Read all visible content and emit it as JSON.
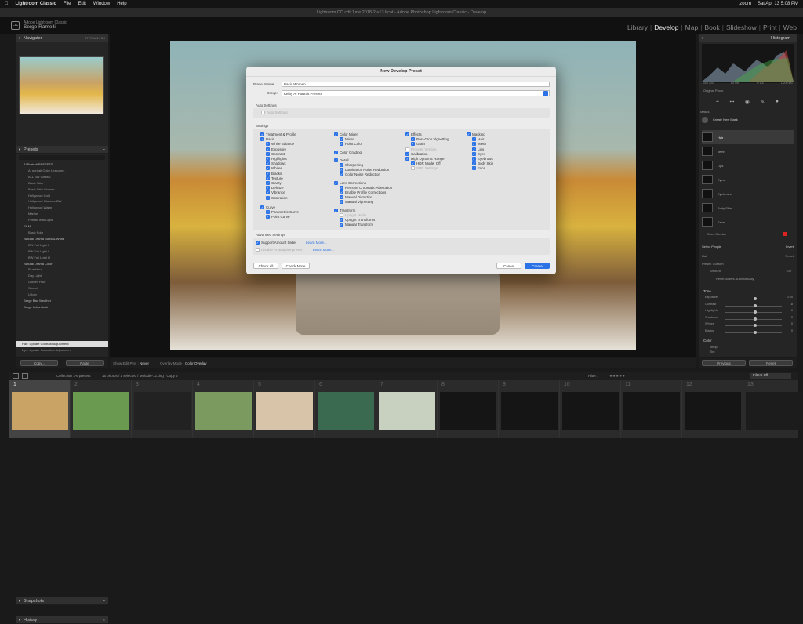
{
  "macbar": {
    "app": "Lightroom Classic",
    "menus": [
      "File",
      "Edit",
      "Window",
      "Help"
    ],
    "right": [
      "zoom",
      "Sat Apr 13 5:08 PM"
    ]
  },
  "window_title": "Lightroom CC cdt June 2018-2-v13.lrcat - Adobe Photoshop Lightroom Classic - Develop",
  "account": {
    "line1": "Adobe Lightroom Classic",
    "name": "Serge Ramelli"
  },
  "modules": [
    "Library",
    "Develop",
    "Map",
    "Book",
    "Slideshow",
    "Print",
    "Web"
  ],
  "active_module": "Develop",
  "left": {
    "navigator": "Navigator",
    "nav_zoom": [
      "FIT",
      "FILL",
      "1:1",
      "3:1"
    ],
    "presets": "Presets",
    "preset_rows": [
      "AI Portrait PRESETS",
      "AI portrait Color Lescu m4",
      "ALL BW Classic",
      "Basic Skin",
      "Basic Skin Woman",
      "Hollywood Cold",
      "Hollywood Glamour BW",
      "Hollywood Warm",
      "Marine",
      "Portrait with Light",
      "FILM",
      "Basic Fdor",
      "Natural Drama Black & White",
      "BW Full Light I",
      "BW Full Light II",
      "BW Full Light III",
      "Natural Drama Color",
      "Blue Hour",
      "Day Light",
      "Golden Hour",
      "Sunset",
      "Urban",
      "Serge Bad Weather",
      "Serge Urban look"
    ],
    "snapshots": "Snapshots",
    "history": "History",
    "history_rows": [
      "Hair: Update Contrast Adjustment",
      "Lips: Update Saturation Adjustment"
    ],
    "copy": "Copy...",
    "paste": "Paste"
  },
  "right": {
    "histogram": "Histogram",
    "hist_vals": [
      "ISO 100",
      "85 mm",
      "f / 1.8",
      "1/200 sec"
    ],
    "original_photo": "Original Photo",
    "masks": "Masks",
    "create_new_mask": "Create New Mask",
    "mask_items": [
      "Hair",
      "Teeth",
      "Lips",
      "Eyes",
      "Eyebrows",
      "Body Skin",
      "Face"
    ],
    "show_overlay": "Show Overlay",
    "select_people": "Select People",
    "invert": "Invert",
    "hair": "Hair",
    "reset": "Reset",
    "preset": "Preset:",
    "preset_val": "Custom",
    "amount": "Amount",
    "amount_val": "100",
    "reset_sliders": "Reset Sliders Automatically",
    "tone": "Tone",
    "sliders": [
      {
        "k": "Exposure",
        "v": "0.00"
      },
      {
        "k": "Contrast",
        "v": "18"
      },
      {
        "k": "Highlights",
        "v": "0"
      },
      {
        "k": "Shadows",
        "v": "0"
      },
      {
        "k": "Whites",
        "v": "0"
      },
      {
        "k": "Blacks",
        "v": "0"
      }
    ],
    "color": "Color",
    "color_rows": [
      "Temp",
      "Tint"
    ],
    "previous": "Previous",
    "reset_btn": "Reset"
  },
  "toolbar": {
    "show_edit_pins": "Show Edit Pins :",
    "never": "Never",
    "overlay_mode": "Overlay Mode :",
    "color_overlay": "Color Overlay"
  },
  "filmbar": {
    "collection": "Collection : AI presets",
    "count": "15 photos / 1 selected / Melodie-12.dng / Copy 2",
    "filter": "Filter :",
    "filters_off": "Filters Off"
  },
  "film_numbers": [
    "1",
    "2",
    "3",
    "4",
    "5",
    "6",
    "7",
    "8",
    "9",
    "10",
    "11",
    "12",
    "13"
  ],
  "dialog": {
    "title": "New Develop Preset",
    "preset_name_label": "Preset Name:",
    "preset_name": "Basic Women",
    "group_label": "Group:",
    "group": "Kelby AI Portrait Presets",
    "auto_settings_header": "Auto Settings",
    "auto_settings": "Auto Settings",
    "settings_header": "Settings",
    "col1": [
      "Treatment & Profile",
      "Basic",
      "White Balance",
      "Exposure",
      "Contrast",
      "Highlights",
      "Shadows",
      "Whites",
      "Blacks",
      "Texture",
      "Clarity",
      "Dehaze",
      "Vibrance",
      "Saturation",
      "Curve",
      "Parametric Curve",
      "Point Curve"
    ],
    "col2": [
      "Color Mixer",
      "Mixer",
      "Point Color",
      "Color Grading",
      "Detail",
      "Sharpening",
      "Luminance Noise Reduction",
      "Color Noise Reduction",
      "Lens Corrections",
      "Remove Chromatic Aberration",
      "Enable Profile Corrections",
      "Manual Distortion",
      "Manual Vignetting",
      "Transform",
      "Upright Mode",
      "Upright Transforms",
      "Manual Transform"
    ],
    "col3": [
      "Effects",
      "Post-Crop Vignetting",
      "Grain",
      "Process Version",
      "Calibration",
      "High Dynamic Range",
      "HDR Mode: Off",
      "SDR Settings"
    ],
    "col4": [
      "Masking",
      "Hair",
      "Teeth",
      "Lips",
      "Eyes",
      "Eyebrows",
      "Body Skin",
      "Face"
    ],
    "advanced_header": "Advanced Settings",
    "support_amount": "Support Amount Slider",
    "disable_ai": "Disable AI adaptive preset",
    "learn_more": "Learn More...",
    "check_all": "Check All",
    "check_none": "Check None",
    "cancel": "Cancel",
    "create": "Create"
  },
  "colors": {
    "accent": "#2a72e6",
    "panel": "#252525",
    "dialog": "#ececec"
  }
}
